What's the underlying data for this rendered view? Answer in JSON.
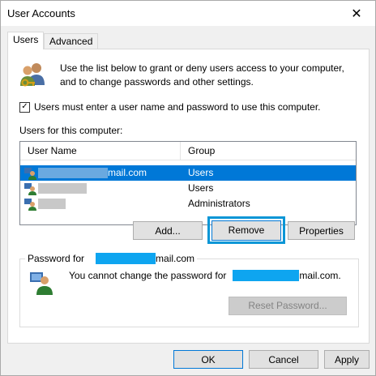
{
  "window": {
    "title": "User Accounts",
    "close_glyph": "✕"
  },
  "tabs": [
    {
      "label": "Users",
      "active": true
    },
    {
      "label": "Advanced",
      "active": false
    }
  ],
  "info": {
    "icon": "users-keys-icon",
    "text": "Use the list below to grant or deny users access to your computer, and to change passwords and other settings."
  },
  "require_login": {
    "checked": true,
    "label": "Users must enter a user name and password to use this computer."
  },
  "users_label": "Users for this computer:",
  "list": {
    "columns": [
      "User Name",
      "Group"
    ],
    "rows": [
      {
        "name_suffix": "mail.com",
        "group": "Users",
        "selected": true,
        "icon": "user-icon"
      },
      {
        "name_suffix": "",
        "group": "Users",
        "selected": false,
        "icon": "user-icon"
      },
      {
        "name_suffix": "",
        "group": "Administrators",
        "selected": false,
        "icon": "user-icon"
      }
    ]
  },
  "buttons": {
    "add": "Add...",
    "remove": "Remove",
    "properties": "Properties"
  },
  "password_group": {
    "legend_prefix": "Password for",
    "legend_suffix": "mail.com",
    "message_prefix": "You cannot change the password for",
    "message_suffix": "mail.com.",
    "reset_label": "Reset Password...",
    "icon": "user-password-icon"
  },
  "footer": {
    "ok": "OK",
    "cancel": "Cancel",
    "apply": "Apply"
  },
  "colors": {
    "selection": "#0078d7",
    "highlight_outline": "#0a96d6",
    "redaction": "#0ea5f0"
  }
}
